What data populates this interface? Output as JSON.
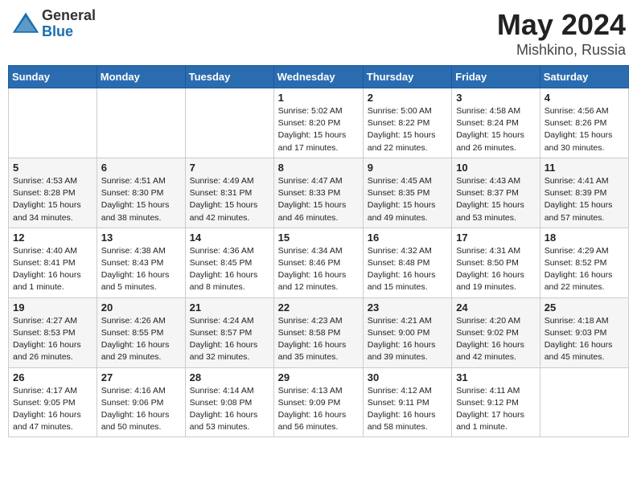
{
  "header": {
    "logo_general": "General",
    "logo_blue": "Blue",
    "title": "May 2024",
    "location": "Mishkino, Russia"
  },
  "days_of_week": [
    "Sunday",
    "Monday",
    "Tuesday",
    "Wednesday",
    "Thursday",
    "Friday",
    "Saturday"
  ],
  "weeks": [
    [
      {
        "day": "",
        "info": ""
      },
      {
        "day": "",
        "info": ""
      },
      {
        "day": "",
        "info": ""
      },
      {
        "day": "1",
        "info": "Sunrise: 5:02 AM\nSunset: 8:20 PM\nDaylight: 15 hours and 17 minutes."
      },
      {
        "day": "2",
        "info": "Sunrise: 5:00 AM\nSunset: 8:22 PM\nDaylight: 15 hours and 22 minutes."
      },
      {
        "day": "3",
        "info": "Sunrise: 4:58 AM\nSunset: 8:24 PM\nDaylight: 15 hours and 26 minutes."
      },
      {
        "day": "4",
        "info": "Sunrise: 4:56 AM\nSunset: 8:26 PM\nDaylight: 15 hours and 30 minutes."
      }
    ],
    [
      {
        "day": "5",
        "info": "Sunrise: 4:53 AM\nSunset: 8:28 PM\nDaylight: 15 hours and 34 minutes."
      },
      {
        "day": "6",
        "info": "Sunrise: 4:51 AM\nSunset: 8:30 PM\nDaylight: 15 hours and 38 minutes."
      },
      {
        "day": "7",
        "info": "Sunrise: 4:49 AM\nSunset: 8:31 PM\nDaylight: 15 hours and 42 minutes."
      },
      {
        "day": "8",
        "info": "Sunrise: 4:47 AM\nSunset: 8:33 PM\nDaylight: 15 hours and 46 minutes."
      },
      {
        "day": "9",
        "info": "Sunrise: 4:45 AM\nSunset: 8:35 PM\nDaylight: 15 hours and 49 minutes."
      },
      {
        "day": "10",
        "info": "Sunrise: 4:43 AM\nSunset: 8:37 PM\nDaylight: 15 hours and 53 minutes."
      },
      {
        "day": "11",
        "info": "Sunrise: 4:41 AM\nSunset: 8:39 PM\nDaylight: 15 hours and 57 minutes."
      }
    ],
    [
      {
        "day": "12",
        "info": "Sunrise: 4:40 AM\nSunset: 8:41 PM\nDaylight: 16 hours and 1 minute."
      },
      {
        "day": "13",
        "info": "Sunrise: 4:38 AM\nSunset: 8:43 PM\nDaylight: 16 hours and 5 minutes."
      },
      {
        "day": "14",
        "info": "Sunrise: 4:36 AM\nSunset: 8:45 PM\nDaylight: 16 hours and 8 minutes."
      },
      {
        "day": "15",
        "info": "Sunrise: 4:34 AM\nSunset: 8:46 PM\nDaylight: 16 hours and 12 minutes."
      },
      {
        "day": "16",
        "info": "Sunrise: 4:32 AM\nSunset: 8:48 PM\nDaylight: 16 hours and 15 minutes."
      },
      {
        "day": "17",
        "info": "Sunrise: 4:31 AM\nSunset: 8:50 PM\nDaylight: 16 hours and 19 minutes."
      },
      {
        "day": "18",
        "info": "Sunrise: 4:29 AM\nSunset: 8:52 PM\nDaylight: 16 hours and 22 minutes."
      }
    ],
    [
      {
        "day": "19",
        "info": "Sunrise: 4:27 AM\nSunset: 8:53 PM\nDaylight: 16 hours and 26 minutes."
      },
      {
        "day": "20",
        "info": "Sunrise: 4:26 AM\nSunset: 8:55 PM\nDaylight: 16 hours and 29 minutes."
      },
      {
        "day": "21",
        "info": "Sunrise: 4:24 AM\nSunset: 8:57 PM\nDaylight: 16 hours and 32 minutes."
      },
      {
        "day": "22",
        "info": "Sunrise: 4:23 AM\nSunset: 8:58 PM\nDaylight: 16 hours and 35 minutes."
      },
      {
        "day": "23",
        "info": "Sunrise: 4:21 AM\nSunset: 9:00 PM\nDaylight: 16 hours and 39 minutes."
      },
      {
        "day": "24",
        "info": "Sunrise: 4:20 AM\nSunset: 9:02 PM\nDaylight: 16 hours and 42 minutes."
      },
      {
        "day": "25",
        "info": "Sunrise: 4:18 AM\nSunset: 9:03 PM\nDaylight: 16 hours and 45 minutes."
      }
    ],
    [
      {
        "day": "26",
        "info": "Sunrise: 4:17 AM\nSunset: 9:05 PM\nDaylight: 16 hours and 47 minutes."
      },
      {
        "day": "27",
        "info": "Sunrise: 4:16 AM\nSunset: 9:06 PM\nDaylight: 16 hours and 50 minutes."
      },
      {
        "day": "28",
        "info": "Sunrise: 4:14 AM\nSunset: 9:08 PM\nDaylight: 16 hours and 53 minutes."
      },
      {
        "day": "29",
        "info": "Sunrise: 4:13 AM\nSunset: 9:09 PM\nDaylight: 16 hours and 56 minutes."
      },
      {
        "day": "30",
        "info": "Sunrise: 4:12 AM\nSunset: 9:11 PM\nDaylight: 16 hours and 58 minutes."
      },
      {
        "day": "31",
        "info": "Sunrise: 4:11 AM\nSunset: 9:12 PM\nDaylight: 17 hours and 1 minute."
      },
      {
        "day": "",
        "info": ""
      }
    ]
  ]
}
